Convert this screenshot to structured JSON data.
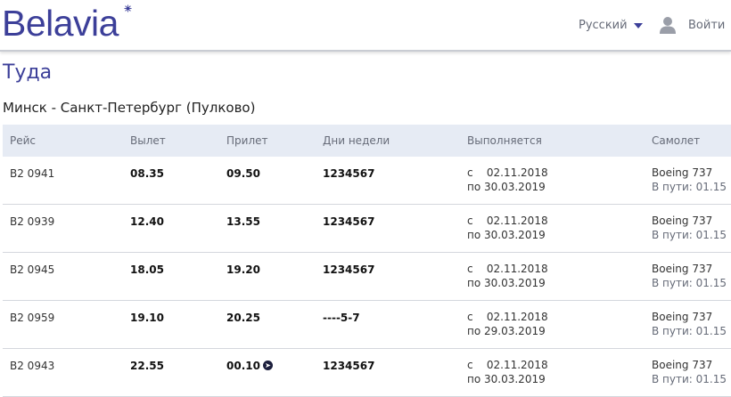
{
  "header": {
    "logo": "Belavia",
    "language": "Русский",
    "login": "Войти",
    "brand_color": "#3c3f99"
  },
  "page": {
    "title": "Туда",
    "route": "Минск - Санкт-Петербург (Пулково)"
  },
  "table": {
    "columns": [
      "Рейс",
      "Вылет",
      "Прилет",
      "Дни недели",
      "Выполняется",
      "Самолет"
    ],
    "rows": [
      {
        "flight": "B2 0941",
        "departure": "08.35",
        "arrival": "09.50",
        "next_day": false,
        "days": "1234567",
        "from_label": "с",
        "from": "02.11.2018",
        "to_label": "по",
        "to": "30.03.2019",
        "aircraft": "Boeing 737",
        "duration_label": "В пути:",
        "duration": "01.15"
      },
      {
        "flight": "B2 0939",
        "departure": "12.40",
        "arrival": "13.55",
        "next_day": false,
        "days": "1234567",
        "from_label": "с",
        "from": "02.11.2018",
        "to_label": "по",
        "to": "30.03.2019",
        "aircraft": "Boeing 737",
        "duration_label": "В пути:",
        "duration": "01.15"
      },
      {
        "flight": "B2 0945",
        "departure": "18.05",
        "arrival": "19.20",
        "next_day": false,
        "days": "1234567",
        "from_label": "с",
        "from": "02.11.2018",
        "to_label": "по",
        "to": "30.03.2019",
        "aircraft": "Boeing 737",
        "duration_label": "В пути:",
        "duration": "01.15"
      },
      {
        "flight": "B2 0959",
        "departure": "19.10",
        "arrival": "20.25",
        "next_day": false,
        "days": "----5-7",
        "from_label": "с",
        "from": "02.11.2018",
        "to_label": "по",
        "to": "29.03.2019",
        "aircraft": "Boeing 737",
        "duration_label": "В пути:",
        "duration": "01.15"
      },
      {
        "flight": "B2 0943",
        "departure": "22.55",
        "arrival": "00.10",
        "next_day": true,
        "days": "1234567",
        "from_label": "с",
        "from": "02.11.2018",
        "to_label": "по",
        "to": "30.03.2019",
        "aircraft": "Boeing 737",
        "duration_label": "В пути:",
        "duration": "01.15"
      }
    ]
  },
  "icons": {
    "language_caret": "chevron-down-icon",
    "user": "user-icon",
    "next_day": "next-day-icon"
  }
}
